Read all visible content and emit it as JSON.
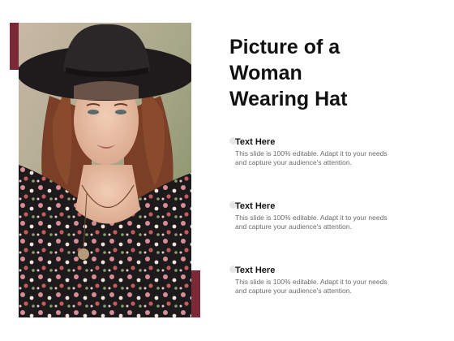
{
  "slide": {
    "title_lines": [
      "Picture of a",
      "Woman",
      "Wearing Hat"
    ],
    "accent_color": "#7b2838",
    "image_subject": "woman-wearing-hat-photo",
    "items": [
      {
        "heading": "Text Here",
        "body_lines": [
          "This slide is 100% editable. Adapt it to your needs",
          "and capture your audience's attention."
        ]
      },
      {
        "heading": "Text Here",
        "body_lines": [
          "This slide is 100% editable. Adapt it to your needs",
          "and capture your audience's attention."
        ]
      },
      {
        "heading": "Text Here",
        "body_lines": [
          "This slide is 100% editable. Adapt it to your needs",
          "and capture your audience's attention."
        ]
      }
    ]
  }
}
